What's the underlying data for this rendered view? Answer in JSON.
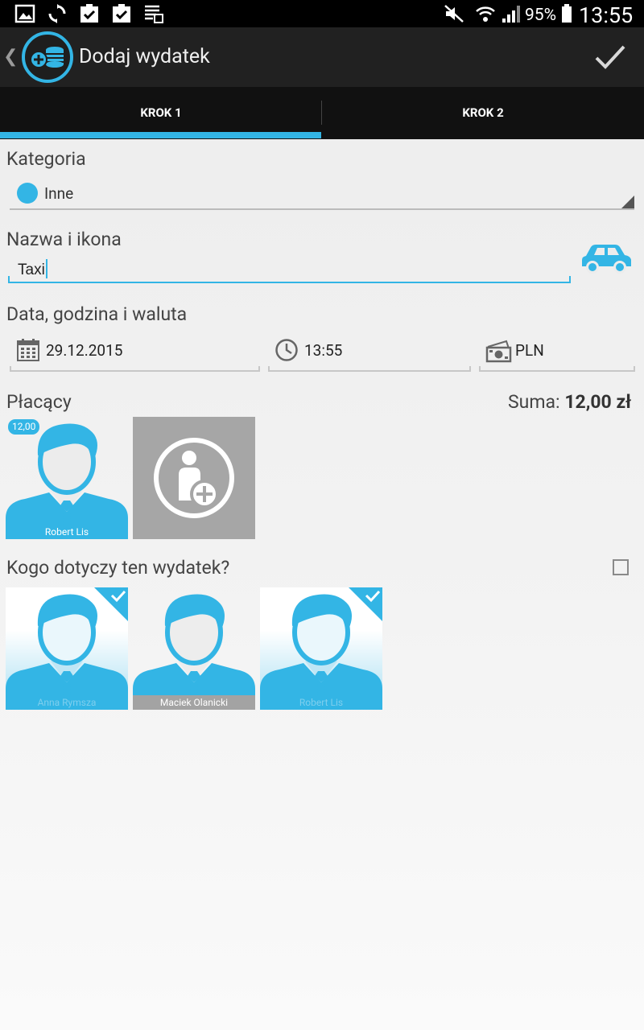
{
  "statusbar": {
    "battery_pct": "95%",
    "time": "13:55"
  },
  "actionbar": {
    "title": "Dodaj wydatek"
  },
  "tabs": [
    {
      "label": "KROK 1"
    },
    {
      "label": "KROK 2"
    }
  ],
  "category": {
    "label": "Kategoria",
    "value": "Inne",
    "color": "#33b5e5"
  },
  "name": {
    "label": "Nazwa i ikona",
    "value": "Taxi",
    "icon": "car-icon"
  },
  "datetime": {
    "label": "Data, godzina i waluta",
    "date": "29.12.2015",
    "time": "13:55",
    "currency": "PLN"
  },
  "payers": {
    "label": "Płacący",
    "sum_label": "Suma:",
    "sum_value": "12,00 zł",
    "people": [
      {
        "name": "Robert Lis",
        "amount": "12,00"
      }
    ]
  },
  "participants": {
    "label": "Kogo dotyczy ten wydatek?",
    "people": [
      {
        "name": "Anna Rymsza",
        "selected": true
      },
      {
        "name": "Maciek Olanicki",
        "selected": false
      },
      {
        "name": "Robert Lis",
        "selected": true
      }
    ]
  },
  "colors": {
    "accent": "#33b5e5",
    "actionbar": "#212121",
    "tabs": "#111111"
  }
}
